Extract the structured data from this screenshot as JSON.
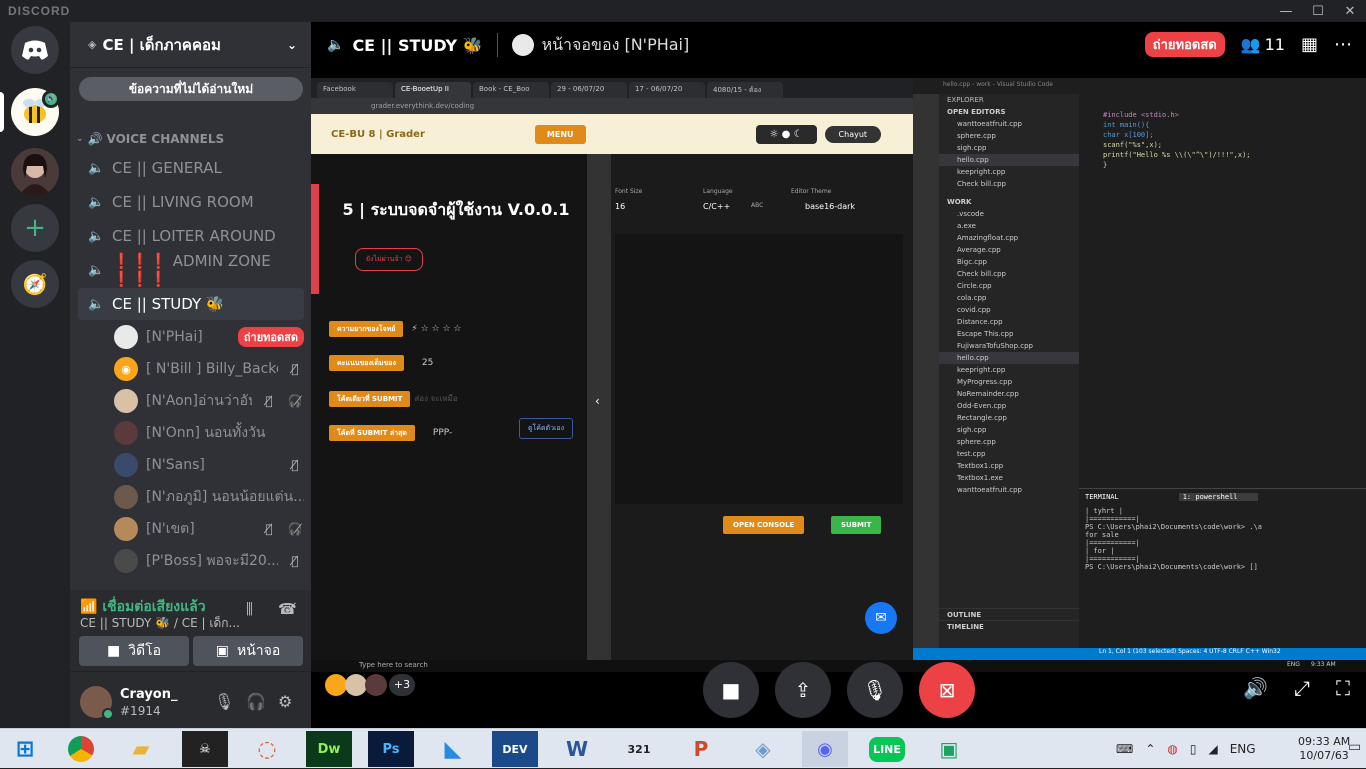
{
  "app": {
    "brand": "DISCORD",
    "win_min": "—",
    "win_max": "☐",
    "win_close": "✕"
  },
  "server": {
    "name": "CE | เด็กภาคคอม",
    "unread": "ข้อความที่ไม่ได้อ่านใหม่",
    "category": "VOICE CHANNELS"
  },
  "channels": [
    {
      "name": "CE || GENERAL"
    },
    {
      "name": "CE || LIVING ROOM"
    },
    {
      "name": "CE || LOITER AROUND"
    },
    {
      "name": "❗❗❗ ADMIN ZONE ❗❗❗"
    },
    {
      "name": "CE || STUDY 🐝"
    }
  ],
  "users": [
    {
      "name": "[N'PHai]",
      "live": "ถ่ายทอดสด",
      "color": "#e9e9e9"
    },
    {
      "name": "[ N'Bill ] Billy_Backer",
      "color": "#faa61a"
    },
    {
      "name": "[N'Aon]อ่านว่าอัน",
      "color": "#d9c1a8"
    },
    {
      "name": "[N'Onn] นอนทั้งวัน",
      "color": "#5a3a3a"
    },
    {
      "name": "[N'Sans]",
      "color": "#3b4a6b"
    },
    {
      "name": "[N'ภอภูมิ] นอนน้อยแต่น...",
      "color": "#6b5a4b"
    },
    {
      "name": "[N'เขต]",
      "color": "#b58a5a"
    },
    {
      "name": "[P'Boss] พอจะมี20...",
      "color": "#4a4a4a"
    }
  ],
  "voice": {
    "status": "เชื่อมต่อเสียงแล้ว",
    "location": "CE || STUDY 🐝 / CE | เด็ก...",
    "video_btn": "วิดีโอ",
    "screen_btn": "หน้าจอ"
  },
  "me": {
    "name": "Crayon_",
    "tag": "#1914"
  },
  "stage": {
    "channel": "CE || STUDY 🐝",
    "viewer": "หน้าจอของ [N'PHai]",
    "live": "ถ่ายทอดสด",
    "count": "11"
  },
  "shared": {
    "tabs": [
      "Facebook",
      "CE-BooetUp II",
      "Book - CE_Boo",
      "29 - 06/07/20",
      "17 - 06/07/20",
      "4080/15 - ต้อง"
    ],
    "url": "grader.everythink.dev/coding",
    "site": "CE-BU 8 | Grader",
    "menu": "MENU",
    "user": "Chayut",
    "problem": "5 | ระบบจดจำผู้ใช้งาน V.0.0.1",
    "badge": "ยังไม่ผ่านจ้า 😊",
    "rows": [
      {
        "k": "ความยากของโจทย์",
        "v": "⚡ ☆ ☆ ☆ ☆"
      },
      {
        "k": "คะแนนของเต็มของ",
        "v": "25"
      },
      {
        "k": "โค้ดเดียวที่ SUBMIT",
        "v": "ส่อง จะเหมือ"
      },
      {
        "k": "โค้ดที่ SUBMIT ล่าสุด",
        "v": "PPP-"
      }
    ],
    "own": "ดูโค้ดตัวเอง",
    "font_l": "Font Size",
    "font_v": "16",
    "lang_l": "Language",
    "lang_v": "C/C++",
    "abc": "ABC",
    "theme_l": "Editor Theme",
    "theme_v": "base16-dark",
    "console": "OPEN CONSOLE",
    "submit": "SUBMIT",
    "vs_title": "hello.cpp - work - Visual Studio Code",
    "vs_menu": [
      "File",
      "Edit",
      "Selection",
      "View",
      "Go",
      "Run",
      "Terminal",
      "Help"
    ],
    "explorer": "EXPLORER",
    "open_editors": "OPEN EDITORS",
    "work": "WORK",
    "open_files": [
      "wanttoeatfruit.cpp",
      "sphere.cpp",
      "sigh.cpp",
      "hello.cpp",
      "keepright.cpp",
      "Check bill.cpp"
    ],
    "files": [
      ".vscode",
      "a.exe",
      "Amazingfloat.cpp",
      "Average.cpp",
      "Bigc.cpp",
      "Check bill.cpp",
      "Circle.cpp",
      "cola.cpp",
      "covid.cpp",
      "Distance.cpp",
      "Escape This.cpp",
      "FujiwaraTofuShop.cpp",
      "hello.cpp",
      "keepright.cpp",
      "MyProgress.cpp",
      "NoRemainder.cpp",
      "Odd-Even.cpp",
      "Rectangle.cpp",
      "sigh.cpp",
      "sphere.cpp",
      "test.cpp",
      "Textbox1.cpp",
      "Textbox1.exe",
      "wanttoeatfruit.cpp"
    ],
    "code": [
      "#include <stdio.h>",
      "int main(){",
      "char x[100];",
      "scanf(\"%s\",x);",
      "printf(\"Hello %s \\\\(\\\"^\\\")/!!!\",x);",
      "}"
    ],
    "term": [
      "|   tyhrt   |",
      "|===========|",
      "PS C:\\Users\\phai2\\Documents\\code\\work> .\\a",
      "for sale",
      "|===========|",
      "|    for    |",
      "|===========|",
      "PS C:\\Users\\phai2\\Documents\\code\\work> []"
    ],
    "term_tab": "TERMINAL",
    "shell": "1: powershell",
    "status": "Ln 1, Col 1 (103 selected)  Spaces: 4  UTF-8  CRLF  C++  Win32",
    "outline": "OUTLINE",
    "timeline": "TIMELINE",
    "win_search": "Type here to search",
    "win_time": "9:33 AM",
    "win_date": "7/10/2020",
    "win_eng": "ENG"
  },
  "taskbar": {
    "time": "09:33 AM",
    "date": "10/07/63",
    "lang": "ENG"
  }
}
